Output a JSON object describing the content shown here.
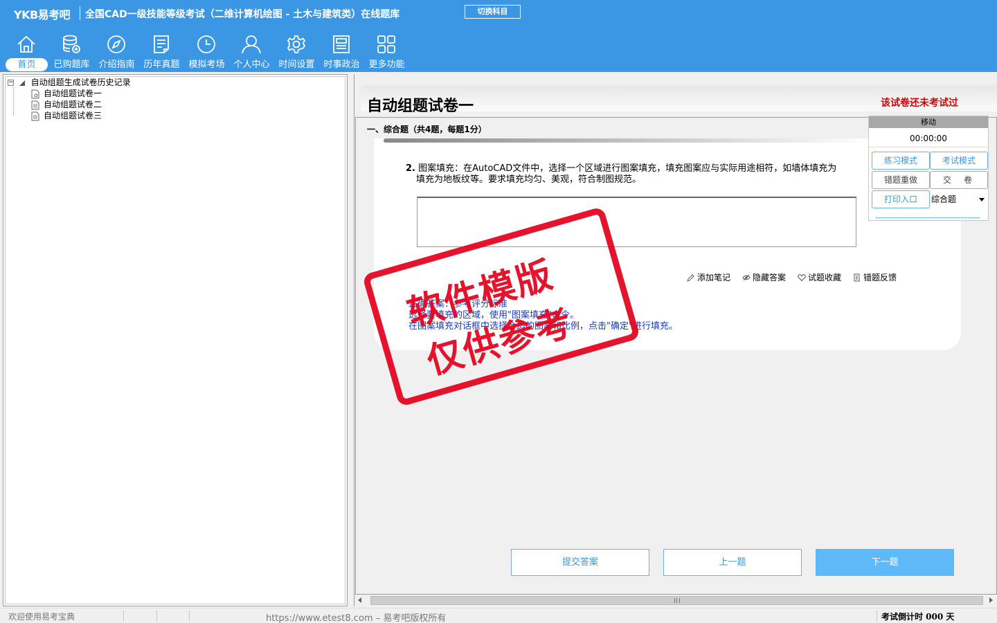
{
  "header": {
    "logo": "YKB易考吧",
    "title": "全国CAD一级技能等级考试（二维计算机绘图 - 土木与建筑类）在线题库",
    "switch_label": "切换科目",
    "nav": [
      {
        "label": "首页",
        "icon": "home-icon",
        "active": true
      },
      {
        "label": "已购题库",
        "icon": "database-icon",
        "active": false
      },
      {
        "label": "介绍指南",
        "icon": "compass-icon",
        "active": false
      },
      {
        "label": "历年真题",
        "icon": "document-list-icon",
        "active": false
      },
      {
        "label": "模拟考场",
        "icon": "clock-icon",
        "active": false
      },
      {
        "label": "个人中心",
        "icon": "user-icon",
        "active": false
      },
      {
        "label": "时间设置",
        "icon": "gear-icon",
        "active": false
      },
      {
        "label": "时事政治",
        "icon": "newspaper-icon",
        "active": false
      },
      {
        "label": "更多功能",
        "icon": "grid-icon",
        "active": false
      }
    ]
  },
  "tree": {
    "root": "自动组题生成试卷历史记录",
    "items": [
      "自动组题试卷一",
      "自动组题试卷二",
      "自动组题试卷三"
    ]
  },
  "paper": {
    "title": "自动组题试卷一",
    "status": "该试卷还未考试过",
    "section": "一、综合题（共4题，每题1分）",
    "question_number": "2.",
    "question_text": "图案填充：在AutoCAD文件中，选择一个区域进行图案填充，填充图案应与实际用途相符，如墙体填充为填充为地板纹等。要求填充均匀、美观，符合制图规范。",
    "question_line1": "图案填充：在AutoCAD文件中，选择一个区域进行图案填充，填充图案应与实际用途相符，如墙体填充为",
    "question_line2": "填充为地板纹等。要求填充均匀、美观，符合制图规范。",
    "tools": [
      {
        "label": "添加笔记",
        "icon": "pencil-icon"
      },
      {
        "label": "隐藏答案",
        "icon": "eye-icon"
      },
      {
        "label": "试题收藏",
        "icon": "heart-icon"
      },
      {
        "label": "错题反馈",
        "icon": "feedback-icon"
      }
    ],
    "answer_lines": [
      "正确答案：参考评分标准",
      "选择要填充的区域，使用\"图案填充\"命令。",
      "在图案填充对话框中选择合适的图案和比例，点击\"确定\"进行填充。"
    ]
  },
  "stamp": {
    "line1": "软件模版",
    "line2": "仅供参考"
  },
  "control": {
    "move_label": "移动",
    "timer": "00:00:00",
    "practice_mode": "练习模式",
    "exam_mode": "考试模式",
    "redo_wrong": "错题重做",
    "submit_paper": "交卷",
    "print_entry": "打印入口",
    "question_type": "综合题"
  },
  "buttons": {
    "submit": "提交答案",
    "prev": "上一题",
    "next": "下一题"
  },
  "statusbar": {
    "welcome": "欢迎使用易考宝典",
    "url": "https://www.etest8.com – 易考吧版权所有",
    "countdown": "考试倒计时 000 天"
  },
  "colors": {
    "header_bg": "#3b96e3",
    "accent": "#3b96e3",
    "status_red": "#d40000",
    "answer_blue": "#1b3bb7",
    "stamp_red": "#e3001b"
  }
}
